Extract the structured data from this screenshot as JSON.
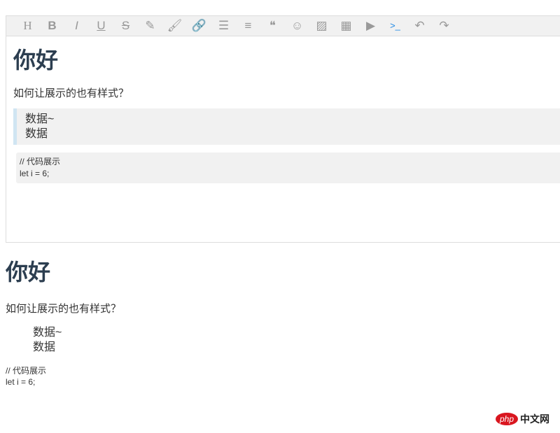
{
  "toolbar": {
    "items": [
      {
        "name": "heading",
        "glyph": "H"
      },
      {
        "name": "bold",
        "glyph": "B"
      },
      {
        "name": "italic",
        "glyph": "I"
      },
      {
        "name": "underline",
        "glyph": "U"
      },
      {
        "name": "strikethrough",
        "glyph": "S"
      },
      {
        "name": "pen",
        "glyph": "✎"
      },
      {
        "name": "brush",
        "glyph": "🖌"
      },
      {
        "name": "link",
        "glyph": "🔗"
      },
      {
        "name": "list",
        "glyph": "☰"
      },
      {
        "name": "align",
        "glyph": "≡"
      },
      {
        "name": "quote",
        "glyph": "❝"
      },
      {
        "name": "emoji",
        "glyph": "☺"
      },
      {
        "name": "image",
        "glyph": "▨"
      },
      {
        "name": "table",
        "glyph": "▦"
      },
      {
        "name": "video",
        "glyph": "▶"
      },
      {
        "name": "code",
        "glyph": ">_"
      },
      {
        "name": "undo",
        "glyph": "↶"
      },
      {
        "name": "redo",
        "glyph": "↷"
      }
    ]
  },
  "content": {
    "heading": "你好",
    "paragraph": "如何让展示的也有样式？",
    "quote": [
      "数据~",
      "数据"
    ],
    "code": [
      "// 代码展示",
      "let i = 6;"
    ]
  },
  "watermark": {
    "php": "php",
    "cn": "中文网"
  }
}
